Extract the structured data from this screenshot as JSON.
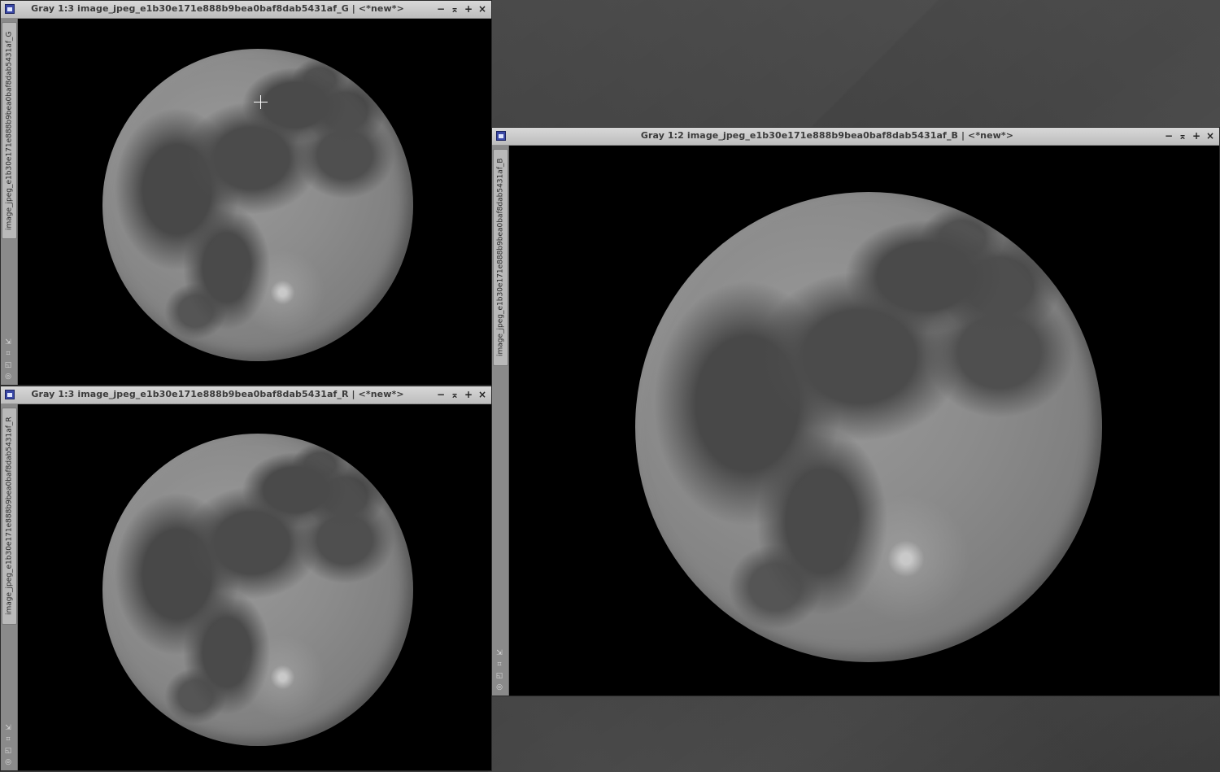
{
  "windows": {
    "g": {
      "title": "Gray 1:3 image_jpeg_e1b30e171e888b9bea0baf8dab5431af_G | <*new*>",
      "side_tab": "image_jpeg_e1b30e171e888b9bea0baf8dab5431af_G"
    },
    "r": {
      "title": "Gray 1:3 image_jpeg_e1b30e171e888b9bea0baf8dab5431af_R | <*new*>",
      "side_tab": "image_jpeg_e1b30e171e888b9bea0baf8dab5431af_R"
    },
    "b": {
      "title": "Gray 1:2 image_jpeg_e1b30e171e888b9bea0baf8dab5431af_B | <*new*>",
      "side_tab": "image_jpeg_e1b30e171e888b9bea0baf8dab5431af_B"
    }
  },
  "controls": {
    "minimize": "−",
    "shade": "⌅",
    "maximize": "+",
    "close": "×"
  },
  "side_tools": {
    "tool1": "⇲",
    "tool2": "⌗",
    "tool3": "◱",
    "tool4": "◎"
  },
  "icons": [
    "window-icon",
    "minimize-icon",
    "shade-icon",
    "maximize-icon",
    "close-icon",
    "crosshair-cursor-icon"
  ]
}
